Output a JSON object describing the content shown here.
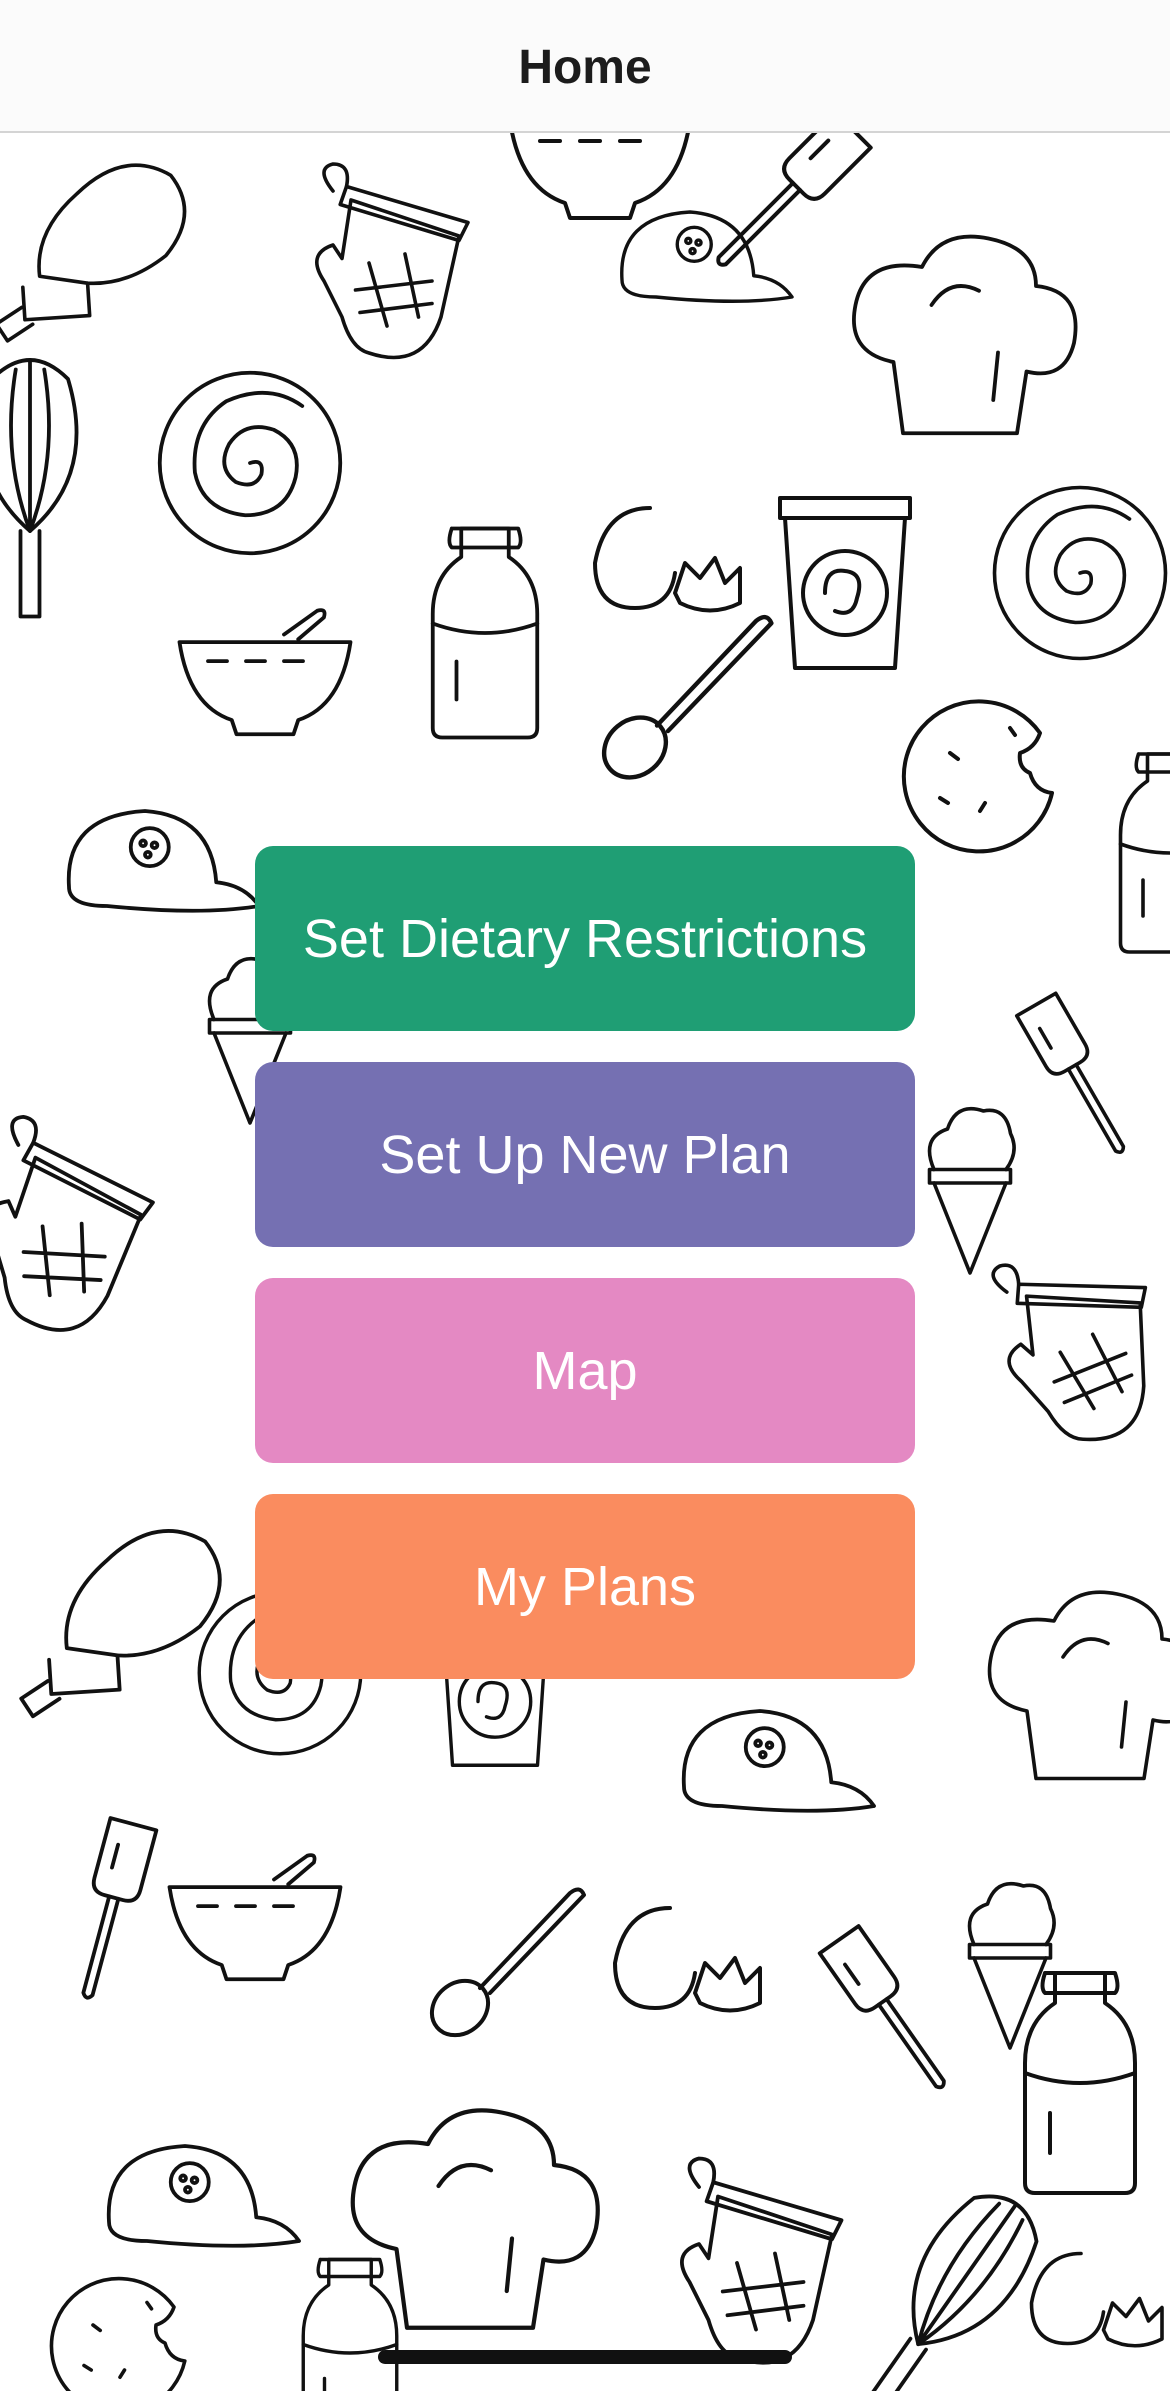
{
  "nav": {
    "title": "Home"
  },
  "menu": {
    "buttons": [
      {
        "label": "Set Dietary Restrictions",
        "color": "#1f9e74"
      },
      {
        "label": "Set Up New Plan",
        "color": "#7570b2"
      },
      {
        "label": "Map",
        "color": "#e489c3"
      },
      {
        "label": "My Plans",
        "color": "#fa8c5f"
      }
    ]
  },
  "background": {
    "icons": [
      "piping-bag-icon",
      "oven-mitt-icon",
      "cookie-icon",
      "cap-icon",
      "chef-hat-icon",
      "cinnamon-roll-icon",
      "whisk-icon",
      "bowl-icon",
      "milk-bottle-icon",
      "egg-icon",
      "cup-icon",
      "spoon-icon",
      "spatula-icon",
      "ice-cream-icon"
    ],
    "line_color": "#111111"
  }
}
